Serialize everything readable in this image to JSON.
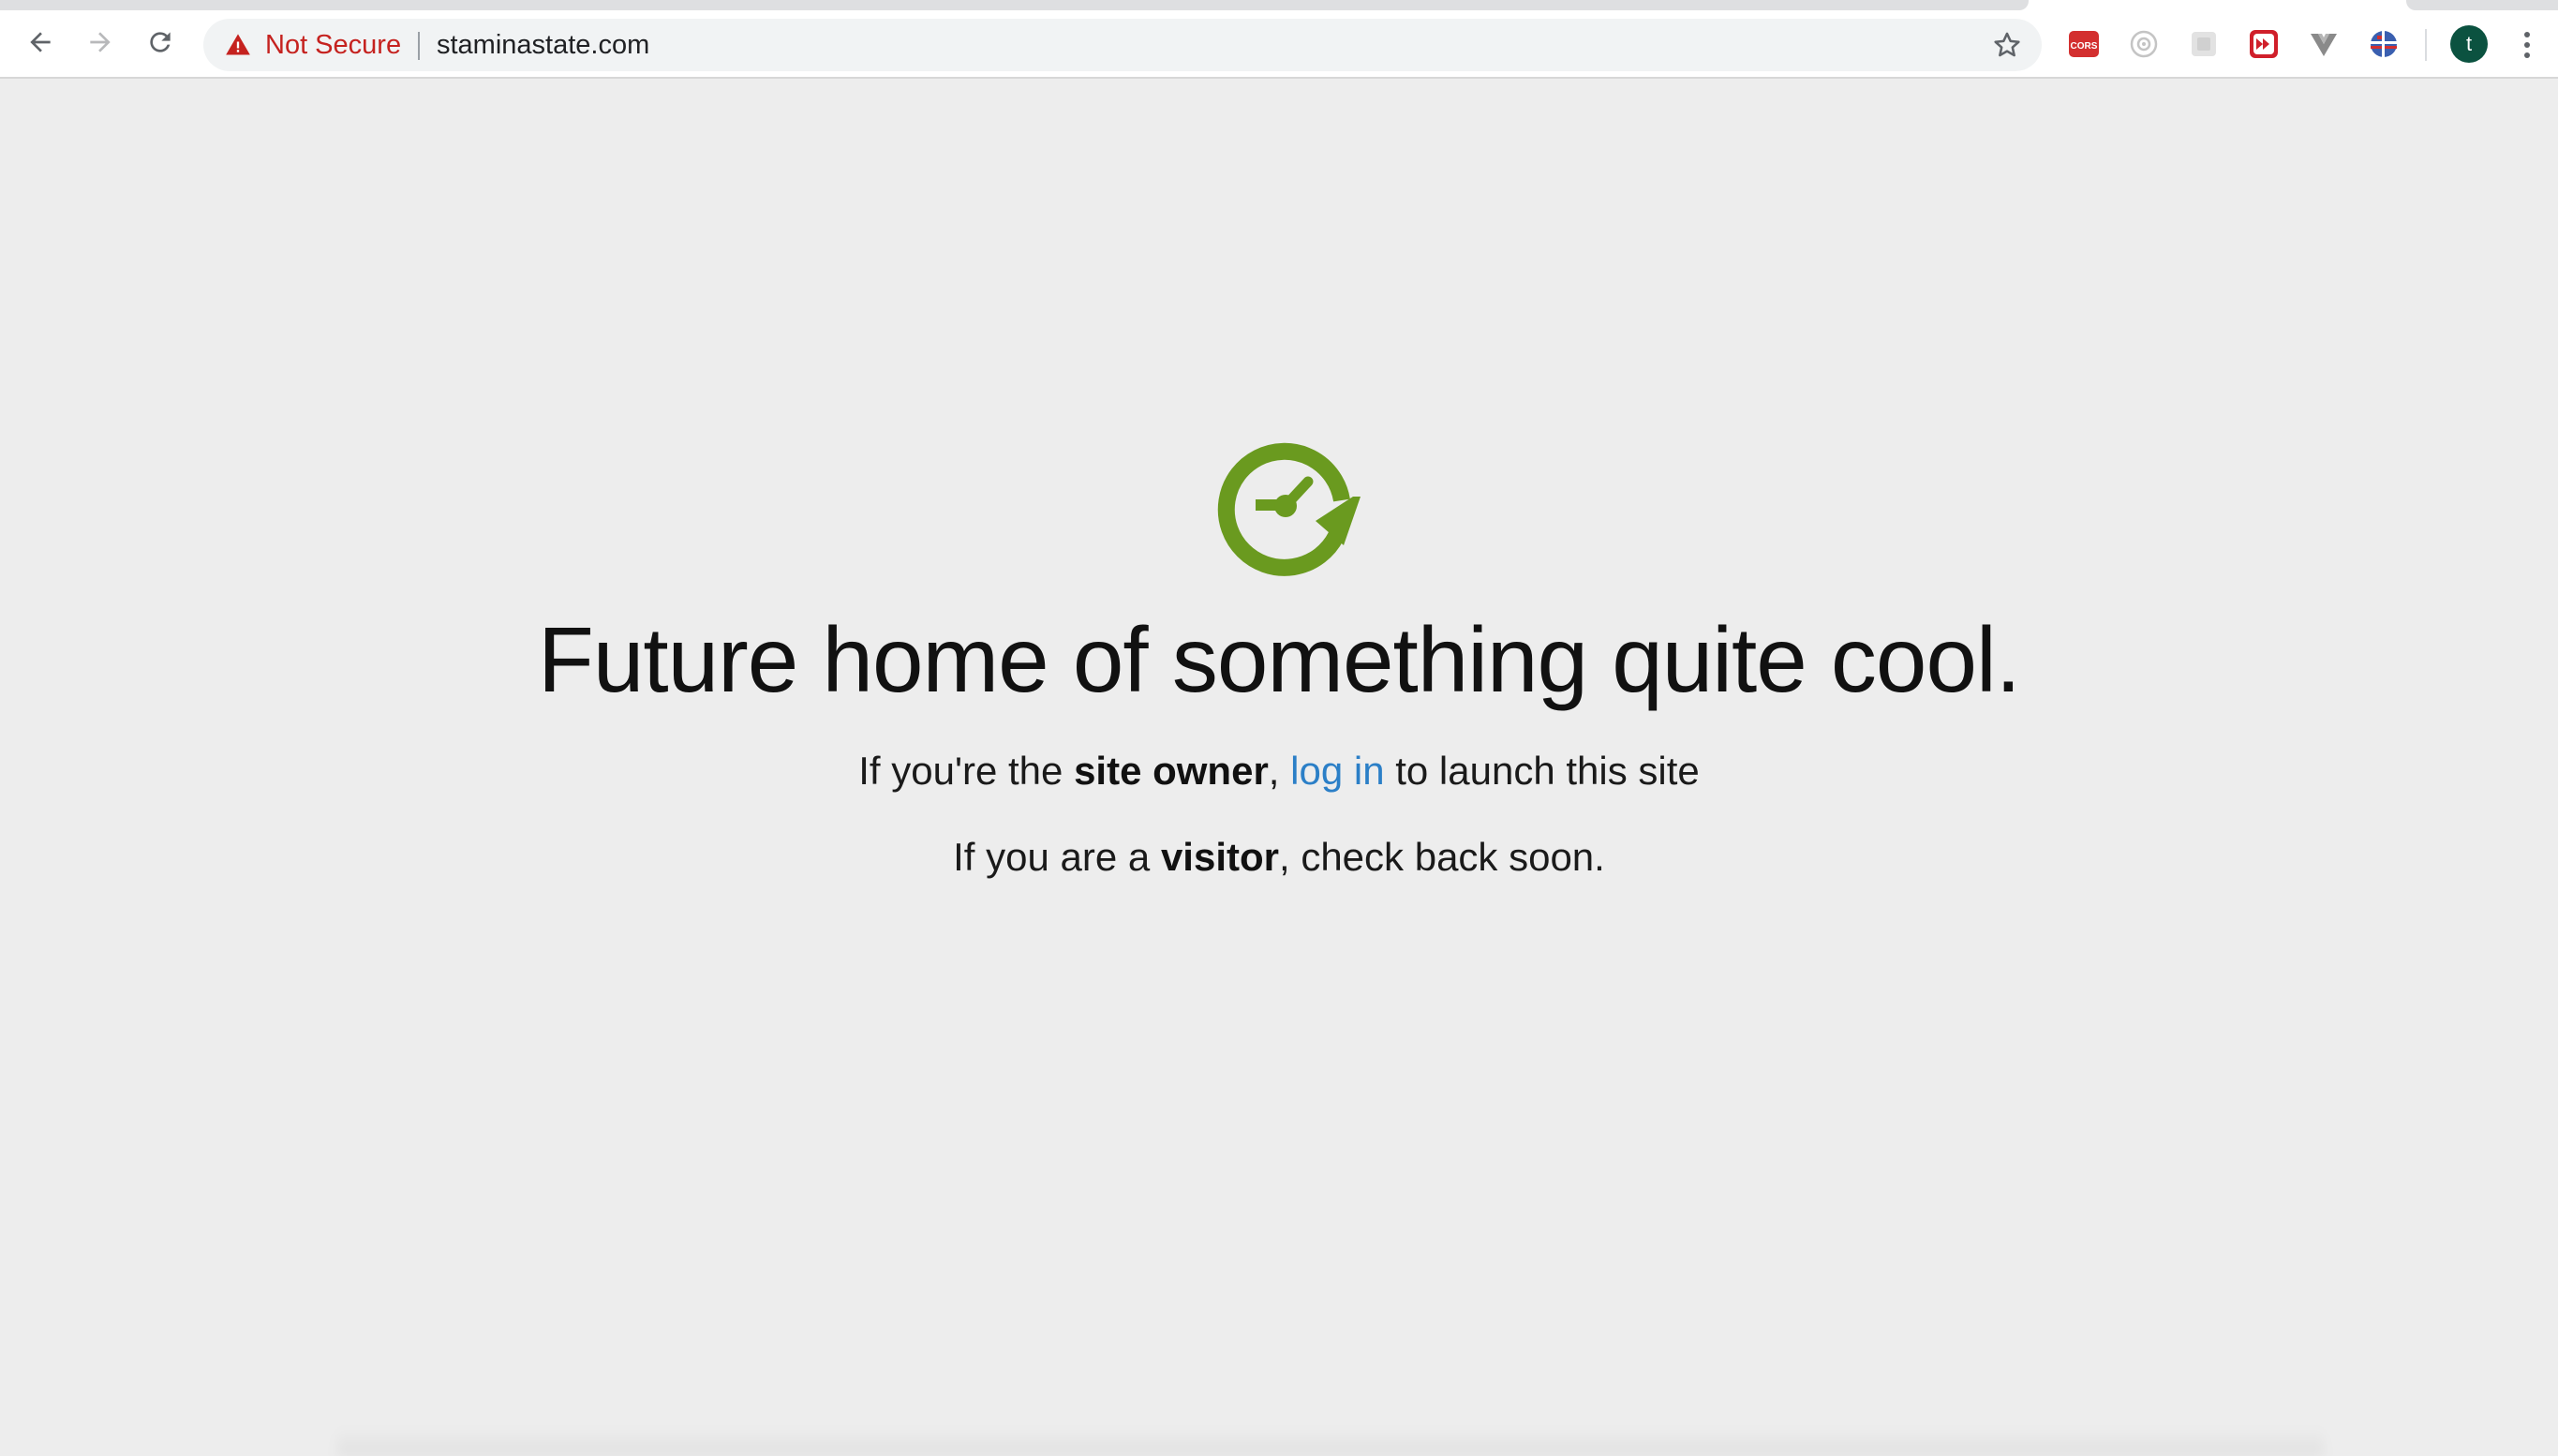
{
  "browser": {
    "security_label": "Not Secure",
    "url": "staminastate.com",
    "profile_initial": "t",
    "icons": {
      "back": "arrow-back-icon",
      "forward": "arrow-forward-icon",
      "reload": "reload-icon",
      "warning": "warning-triangle-icon",
      "bookmark": "star-icon",
      "menu": "vertical-dots-icon"
    },
    "extensions": [
      {
        "name": "cors-extension-icon",
        "label": "CORS",
        "color": "#d32f2f"
      },
      {
        "name": "react-devtools-icon",
        "color": "#b0b0b0"
      },
      {
        "name": "gray-extension-icon",
        "color": "#c8c8c8"
      },
      {
        "name": "fast-forward-extension-icon",
        "color": "#d01f2a"
      },
      {
        "name": "vue-devtools-icon",
        "color": "#8a8a8a"
      },
      {
        "name": "flag-extension-icon",
        "color": "#3a5fb0"
      }
    ],
    "avatar_color": "#0b5240"
  },
  "page": {
    "logo": "green-clock-refresh-icon",
    "logo_color": "#6a9a1f",
    "headline": "Future home of something quite cool.",
    "owner_line": {
      "prefix": "If you're the ",
      "bold": "site owner",
      "comma": ", ",
      "link": "log in",
      "suffix": " to launch this site"
    },
    "visitor_line": {
      "prefix": "If you are a ",
      "bold": "visitor",
      "suffix": ", check back soon."
    },
    "link_color": "#2b7fc7"
  }
}
